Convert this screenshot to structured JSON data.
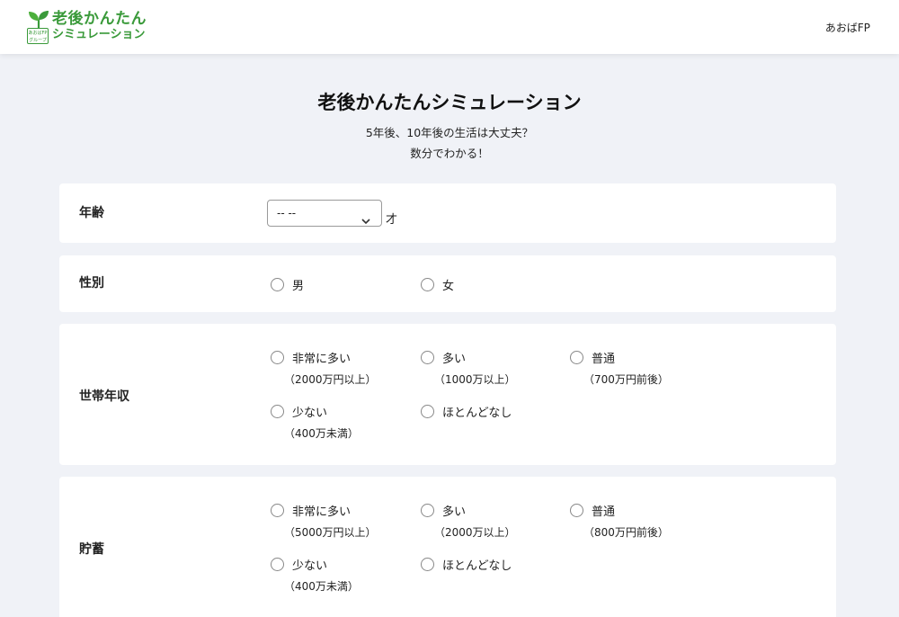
{
  "header": {
    "logo_line1": "老後かんたん",
    "logo_line2": "シミュレーション",
    "logo_badge": "あおばFP グループ",
    "user_name": "あおばFP"
  },
  "hero": {
    "title": "老後かんたんシミュレーション",
    "subtitle_line1": "5年後、10年後の生活は大丈夫？",
    "subtitle_line2": "数分でわかる！"
  },
  "age": {
    "label": "年齢",
    "selected_value": "-- --",
    "unit": "才"
  },
  "gender": {
    "label": "性別",
    "options": [
      {
        "label": "男"
      },
      {
        "label": "女"
      }
    ]
  },
  "income": {
    "label": "世帯年収",
    "options": [
      {
        "label": "非常に多い",
        "sub": "（2000万円以上）"
      },
      {
        "label": "多い",
        "sub": "（1000万以上）"
      },
      {
        "label": "普通",
        "sub": "（700万円前後）"
      },
      {
        "label": "少ない",
        "sub": "（400万未満）"
      },
      {
        "label": "ほとんどなし",
        "sub": ""
      }
    ]
  },
  "savings": {
    "label": "貯蓄",
    "options": [
      {
        "label": "非常に多い",
        "sub": "（5000万円以上）"
      },
      {
        "label": "多い",
        "sub": "（2000万以上）"
      },
      {
        "label": "普通",
        "sub": "（800万円前後）"
      },
      {
        "label": "少ない",
        "sub": "（400万未満）"
      },
      {
        "label": "ほとんどなし",
        "sub": ""
      }
    ]
  },
  "colors": {
    "brand_green": "#3a9a3a",
    "page_background": "#f0f2f7"
  }
}
